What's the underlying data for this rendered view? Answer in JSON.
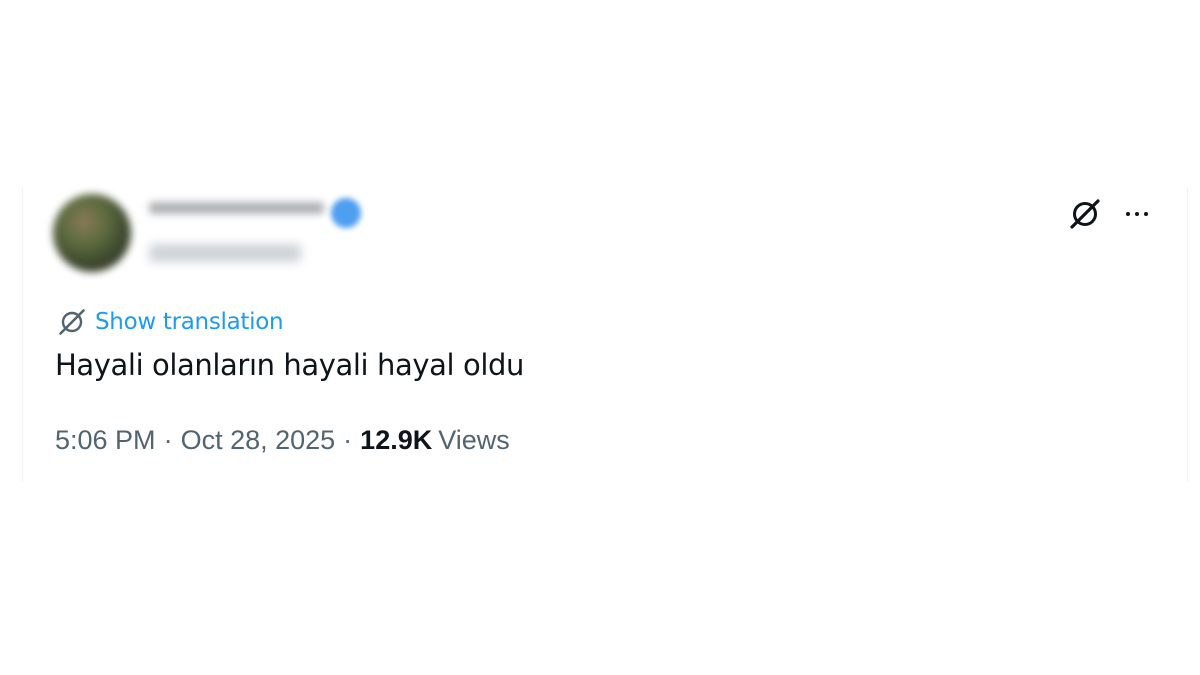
{
  "tweet": {
    "author": {
      "display_name": "",
      "handle": "",
      "verified": true
    },
    "translate_label": "Show translation",
    "text": "Hayali olanların hayali hayal oldu",
    "time": "5:06 PM",
    "separator": "·",
    "date": "Oct 28, 2025",
    "views_count": "12.9K",
    "views_label": "Views"
  },
  "icons": {
    "grok": "grok-icon",
    "more": "more-icon",
    "translate": "grok-icon"
  },
  "colors": {
    "accent": "#1d9bf0",
    "text": "#0f1419",
    "secondary": "#536471",
    "verified": "#4d9ff0"
  }
}
